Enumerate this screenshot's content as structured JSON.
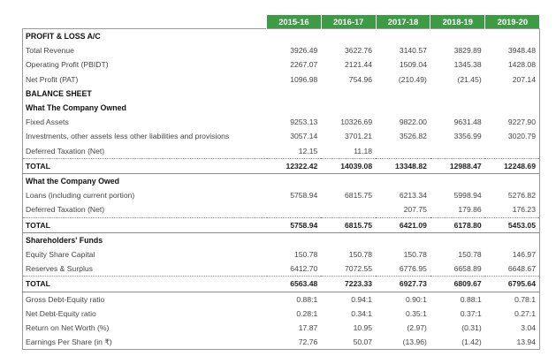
{
  "years": [
    "2015-16",
    "2016-17",
    "2017-18",
    "2018-19",
    "2019-20"
  ],
  "rows": [
    {
      "type": "hdr",
      "label": "PROFIT & LOSS A/C",
      "values": [
        "",
        "",
        "",
        "",
        ""
      ]
    },
    {
      "type": "data",
      "label": "Total Revenue",
      "values": [
        "3926.49",
        "3622.76",
        "3140.57",
        "3829.89",
        "3948.48"
      ]
    },
    {
      "type": "data",
      "label": "Operating Profit (PBIDT)",
      "values": [
        "2267.07",
        "2121.44",
        "1509.04",
        "1345.38",
        "1428.08"
      ]
    },
    {
      "type": "data",
      "label": "Net Profit (PAT)",
      "values": [
        "1096.98",
        "754.96",
        "(210.49)",
        "(21.45)",
        "207.14"
      ]
    },
    {
      "type": "hdr",
      "label": "BALANCE SHEET",
      "values": [
        "",
        "",
        "",
        "",
        ""
      ]
    },
    {
      "type": "hdr",
      "label": "What The Company Owned",
      "values": [
        "",
        "",
        "",
        "",
        ""
      ]
    },
    {
      "type": "data",
      "label": "Fixed Assets",
      "values": [
        "9253.13",
        "10326.69",
        "9822.00",
        "9631.48",
        "9227.90"
      ]
    },
    {
      "type": "data",
      "label": "Investments, other assets less other liabilities and provisions",
      "values": [
        "3057.14",
        "3701.21",
        "3526.82",
        "3356.99",
        "3020.79"
      ]
    },
    {
      "type": "data",
      "label": "Deferred Taxation (Net)",
      "values": [
        "12.15",
        "11.18",
        "",
        "",
        ""
      ]
    },
    {
      "type": "total",
      "label": "TOTAL",
      "values": [
        "12322.42",
        "14039.08",
        "13348.82",
        "12988.47",
        "12248.69"
      ]
    },
    {
      "type": "hdr",
      "label": "What the Company Owed",
      "values": [
        "",
        "",
        "",
        "",
        ""
      ]
    },
    {
      "type": "data",
      "label": "Loans (including current portion)",
      "values": [
        "5758.94",
        "6815.75",
        "6213.34",
        "5998.94",
        "5276.82"
      ]
    },
    {
      "type": "data",
      "label": "Deferred Taxation (Net)",
      "values": [
        "",
        "",
        "207.75",
        "179.86",
        "176.23"
      ]
    },
    {
      "type": "total",
      "label": "TOTAL",
      "values": [
        "5758.94",
        "6815.75",
        "6421.09",
        "6178.80",
        "5453.05"
      ]
    },
    {
      "type": "hdr",
      "label": "Shareholders' Funds",
      "values": [
        "",
        "",
        "",
        "",
        ""
      ]
    },
    {
      "type": "data",
      "label": "Equity Share Capital",
      "values": [
        "150.78",
        "150.78",
        "150.78",
        "150.78",
        "146.97"
      ]
    },
    {
      "type": "data",
      "label": "Reserves & Surplus",
      "values": [
        "6412.70",
        "7072.55",
        "6776.95",
        "6658.89",
        "6648.67"
      ]
    },
    {
      "type": "total",
      "label": "TOTAL",
      "values": [
        "6563.48",
        "7223.33",
        "6927.73",
        "6809.67",
        "6795.64"
      ]
    },
    {
      "type": "data",
      "label": "Gross Debt-Equity ratio",
      "values": [
        "0.88:1",
        "0.94:1",
        "0.90:1",
        "0.88:1",
        "0.78:1"
      ]
    },
    {
      "type": "data",
      "label": "Net Debt-Equity ratio",
      "values": [
        "0.28:1",
        "0.34:1",
        "0.35:1",
        "0.37:1",
        "0.27:1"
      ]
    },
    {
      "type": "data",
      "label": "Return on Net Worth (%)",
      "values": [
        "17.87",
        "10.95",
        "(2.97)",
        "(0.31)",
        "3.04"
      ]
    },
    {
      "type": "data",
      "label": "Earnings Per Share (in ₹)",
      "values": [
        "72.76",
        "50.07",
        "(13.96)",
        "(1.42)",
        "13.94"
      ]
    }
  ]
}
